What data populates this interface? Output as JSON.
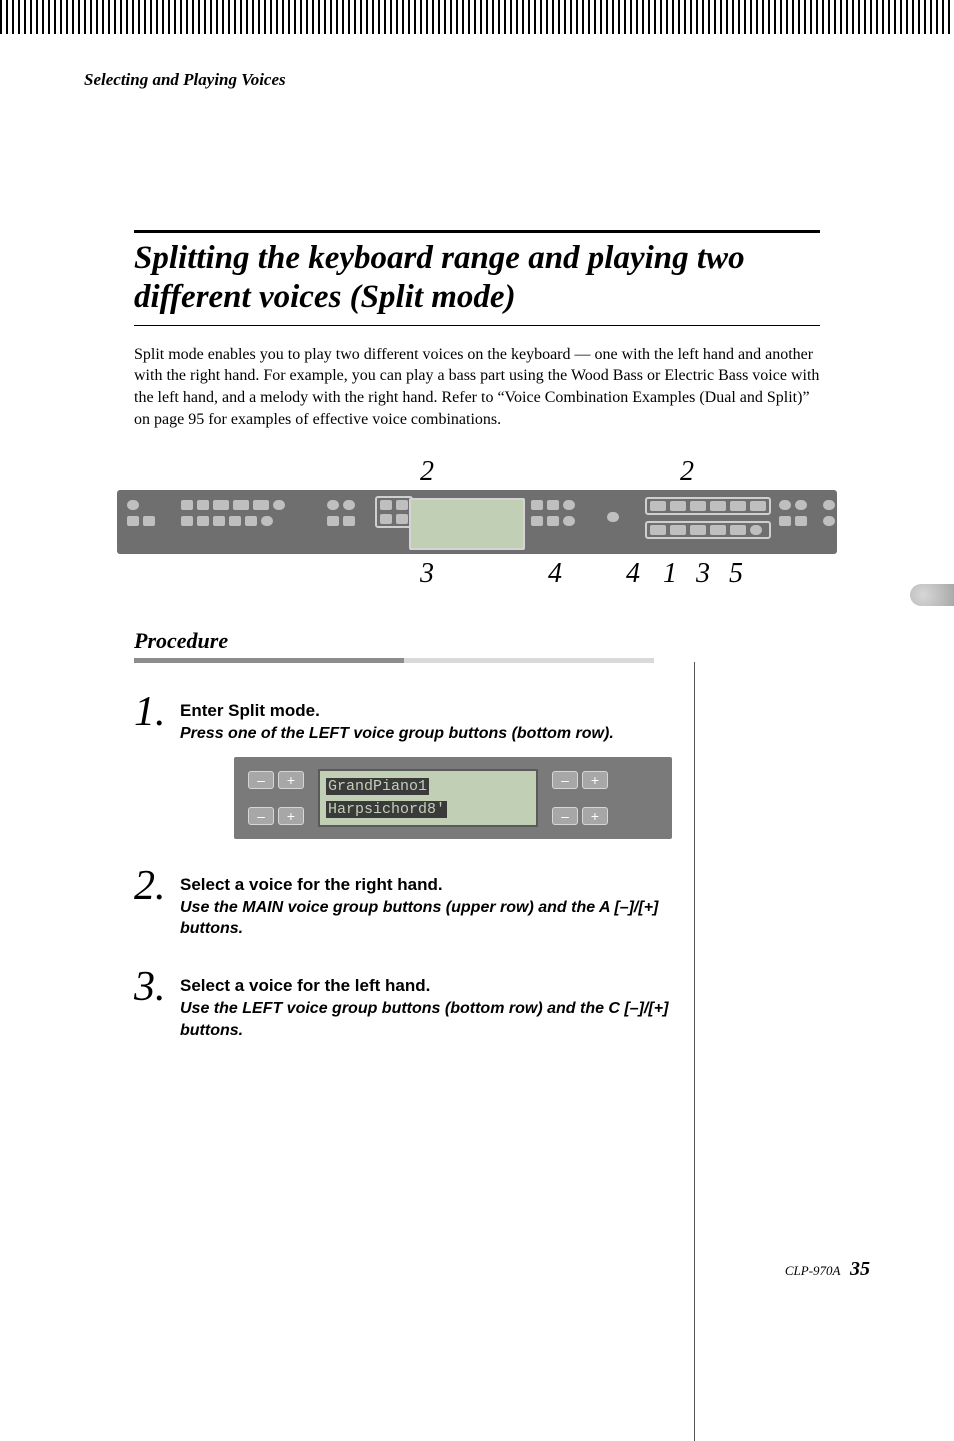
{
  "running_head": "Selecting and Playing Voices",
  "section_title": "Splitting the keyboard range and playing two different voices (Split mode)",
  "intro": "Split mode enables you to play two different voices on the keyboard — one with the left hand and another with the right hand. For example, you can play a bass part using the Wood Bass or Electric Bass voice with the left hand, and a melody with the right hand. Refer to “Voice Combination Examples (Dual and Split)” on page 95 for examples of effective voice combinations.",
  "panel_callouts_top": {
    "left": "2",
    "right": "2"
  },
  "panel_callouts_bottom": {
    "a": "3",
    "b": "4",
    "c": "4",
    "d": "1 3 5"
  },
  "procedure_title": "Procedure",
  "steps": [
    {
      "num": "1.",
      "head": "Enter Split mode.",
      "sub": "Press one of the LEFT voice group buttons (bottom row)."
    },
    {
      "num": "2.",
      "head": "Select a voice for the right hand.",
      "sub": "Use the MAIN voice group buttons (upper row) and the A [–]/[+] buttons."
    },
    {
      "num": "3.",
      "head": "Select a voice for the left hand.",
      "sub": "Use the LEFT voice group buttons (bottom row) and the C [–]/[+] buttons."
    }
  ],
  "lcd": {
    "line1": "GrandPiano1",
    "line2": "Harpsichord8'",
    "minus": "–",
    "plus": "+"
  },
  "footer": {
    "model": "CLP-970A",
    "page": "35"
  }
}
